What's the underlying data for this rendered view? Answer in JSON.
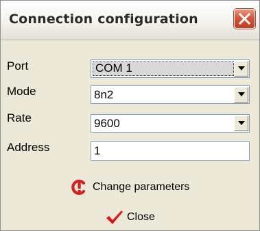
{
  "window": {
    "title": "Connection configuration"
  },
  "fields": {
    "port": {
      "label": "Port",
      "value": "COM 1"
    },
    "mode": {
      "label": "Mode",
      "value": "8n2"
    },
    "rate": {
      "label": "Rate",
      "value": "9600"
    },
    "address": {
      "label": "Address",
      "value": "1"
    }
  },
  "actions": {
    "change_parameters": {
      "label": "Change parameters",
      "icon": "change-parameters-icon"
    },
    "close": {
      "label": "Close",
      "icon": "checkmark-icon"
    }
  },
  "colors": {
    "close_button": "#c9482b",
    "change_icon": "#d21f1f",
    "checkmark": "#d61a1a",
    "dialog_bg": "#ece9d8"
  }
}
